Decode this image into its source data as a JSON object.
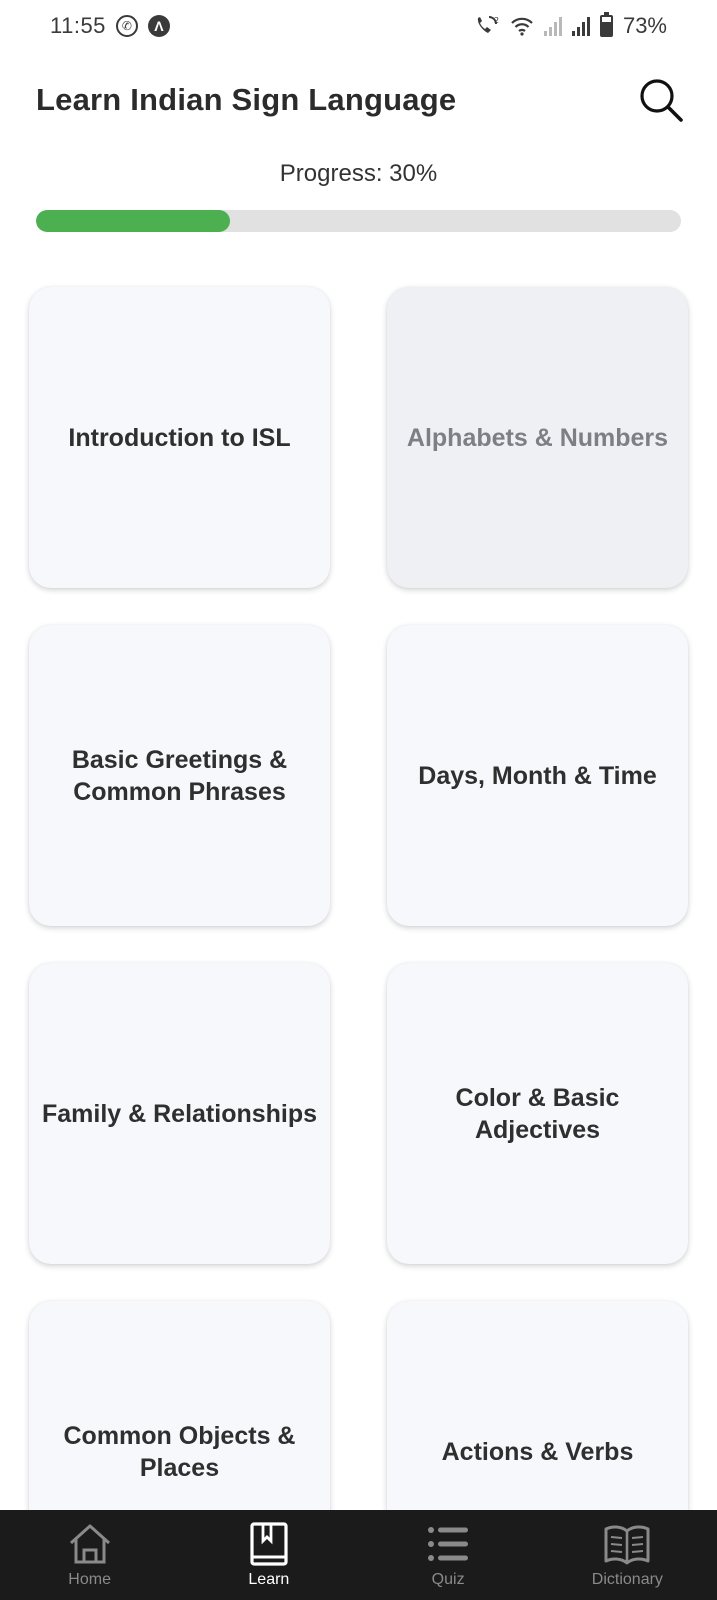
{
  "status_bar": {
    "time": "11:55",
    "battery_text": "73%",
    "battery_level": 0.73,
    "left_icons": [
      "whatsapp-icon",
      "a-badge-icon"
    ],
    "right_icons": [
      "wifi-call-icon",
      "wifi-icon",
      "signal-icon",
      "signal-icon",
      "battery-icon"
    ]
  },
  "header": {
    "title": "Learn Indian Sign Language",
    "search_icon": "search-icon"
  },
  "progress": {
    "label": "Progress: 30%",
    "value": 0.3,
    "fill_color": "#4caf50",
    "track_color": "#e1e1e1"
  },
  "cards": [
    {
      "label": "Introduction to ISL",
      "state": "enabled"
    },
    {
      "label": "Alphabets & Numbers",
      "state": "disabled"
    },
    {
      "label": "Basic Greetings &\nCommon Phrases",
      "state": "enabled"
    },
    {
      "label": "Days, Month & Time",
      "state": "enabled"
    },
    {
      "label": "Family & Relationships",
      "state": "enabled"
    },
    {
      "label": "Color & Basic\nAdjectives",
      "state": "enabled"
    },
    {
      "label": "Common Objects &\nPlaces",
      "state": "enabled"
    },
    {
      "label": "Actions & Verbs",
      "state": "enabled"
    }
  ],
  "bottom_nav": {
    "items": [
      {
        "label": "Home",
        "icon": "home-icon",
        "active": false
      },
      {
        "label": "Learn",
        "icon": "book-icon",
        "active": true
      },
      {
        "label": "Quiz",
        "icon": "list-icon",
        "active": false
      },
      {
        "label": "Dictionary",
        "icon": "open-book-icon",
        "active": false
      }
    ],
    "background": "#1b1b1b"
  }
}
